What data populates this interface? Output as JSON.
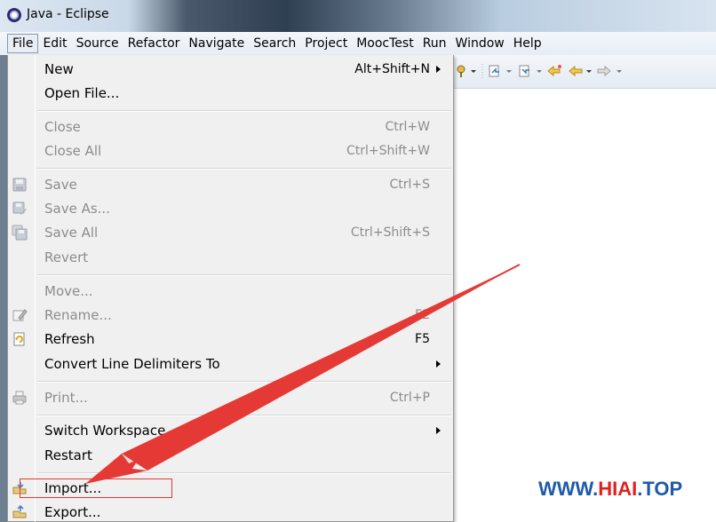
{
  "window": {
    "title": "Java - Eclipse"
  },
  "menubar": {
    "items": [
      "File",
      "Edit",
      "Source",
      "Refactor",
      "Navigate",
      "Search",
      "Project",
      "MoocTest",
      "Run",
      "Window",
      "Help"
    ],
    "active": "File"
  },
  "file_menu": {
    "new": {
      "label": "New",
      "accel": "Alt+Shift+N"
    },
    "open_file": {
      "label": "Open File..."
    },
    "close": {
      "label": "Close",
      "accel": "Ctrl+W"
    },
    "close_all": {
      "label": "Close All",
      "accel": "Ctrl+Shift+W"
    },
    "save": {
      "label": "Save",
      "accel": "Ctrl+S"
    },
    "save_as": {
      "label": "Save As..."
    },
    "save_all": {
      "label": "Save All",
      "accel": "Ctrl+Shift+S"
    },
    "revert": {
      "label": "Revert"
    },
    "move": {
      "label": "Move..."
    },
    "rename": {
      "label": "Rename...",
      "accel": "F2"
    },
    "refresh": {
      "label": "Refresh",
      "accel": "F5"
    },
    "convert": {
      "label": "Convert Line Delimiters To"
    },
    "print": {
      "label": "Print...",
      "accel": "Ctrl+P"
    },
    "switch_workspace": {
      "label": "Switch Workspace"
    },
    "restart": {
      "label": "Restart"
    },
    "import": {
      "label": "Import..."
    },
    "export": {
      "label": "Export..."
    }
  },
  "watermark": {
    "part1": "WWW.",
    "part2": "HIAI",
    "part3": ".TOP"
  },
  "colors": {
    "annotation": "#e53935",
    "watermark_blue": "#1e5aa8",
    "watermark_red": "#e02020"
  }
}
